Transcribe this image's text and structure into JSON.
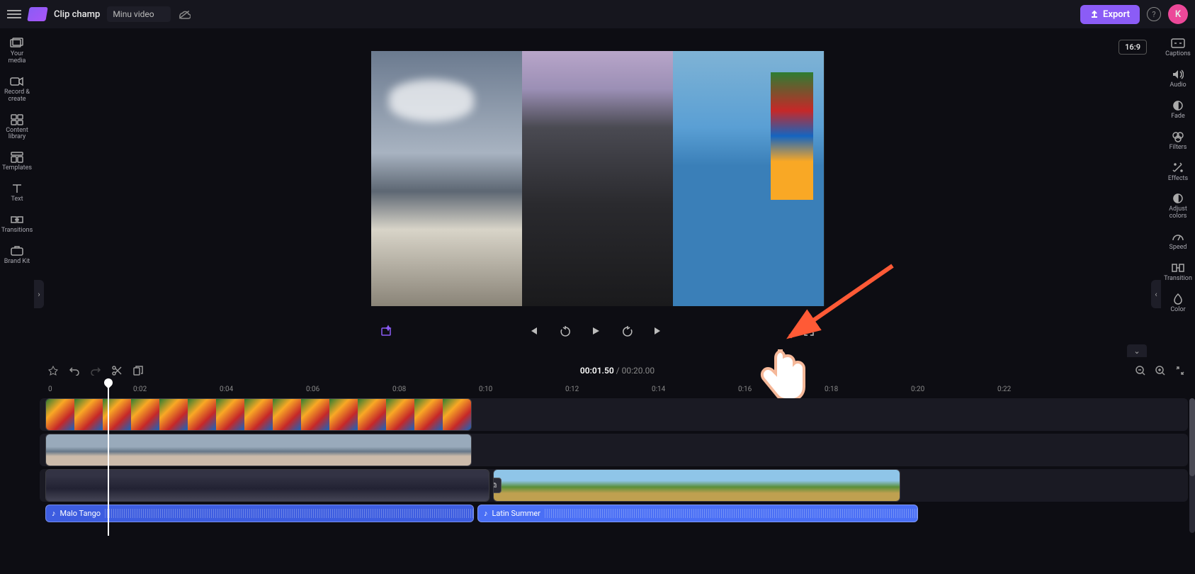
{
  "header": {
    "brand": "Clip champ",
    "project_title": "Minu video",
    "export_label": "Export",
    "avatar_initial": "K"
  },
  "left_sidebar": {
    "items": [
      {
        "label": "Your media"
      },
      {
        "label": "Record & create"
      },
      {
        "label": "Content library"
      },
      {
        "label": "Templates"
      },
      {
        "label": "Text"
      },
      {
        "label": "Transitions"
      },
      {
        "label": "Brand Kit"
      }
    ]
  },
  "right_sidebar": {
    "items": [
      {
        "label": "Captions"
      },
      {
        "label": "Audio"
      },
      {
        "label": "Fade"
      },
      {
        "label": "Filters"
      },
      {
        "label": "Effects"
      },
      {
        "label": "Adjust colors"
      },
      {
        "label": "Speed"
      },
      {
        "label": "Transition"
      },
      {
        "label": "Color"
      }
    ]
  },
  "preview": {
    "aspect_ratio": "16:9"
  },
  "timeline": {
    "current_time": "00:01.50",
    "total_time": "00:20.00",
    "ticks": [
      "0",
      "0:02",
      "0:04",
      "0:06",
      "0:08",
      "0:10",
      "0:12",
      "0:14",
      "0:16",
      "0:18",
      "0:20",
      "0:22"
    ],
    "audio_clips": [
      {
        "title": "Malo Tango"
      },
      {
        "title": "Latin Summer"
      }
    ]
  }
}
